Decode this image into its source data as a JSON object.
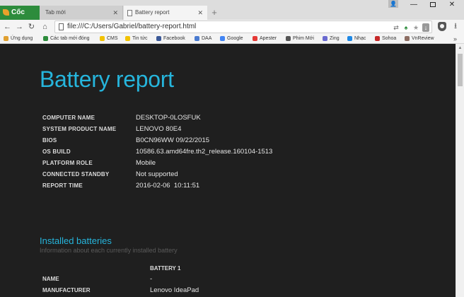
{
  "browser": {
    "brand": "Cốc Cốc",
    "tabs": [
      {
        "title": "Tab mới",
        "active": false
      },
      {
        "title": "Battery report",
        "active": true
      }
    ],
    "new_tab_symbol": "+",
    "window_controls": {
      "minimize": "—",
      "close": "✕"
    },
    "address": {
      "url": "file:///C:/Users/Gabriel/battery-report.html"
    },
    "bookmarks": [
      {
        "label": "Ứng dụng",
        "color": "#e0a030"
      },
      {
        "label": "Các tab mới đóng",
        "color": "#2d8c3c"
      },
      {
        "label": "CMS",
        "color": "#f2c200"
      },
      {
        "label": "Tin tức",
        "color": "#f2c200"
      },
      {
        "label": "Facebook",
        "color": "#3b5998"
      },
      {
        "label": "DAA",
        "color": "#4a7bd0"
      },
      {
        "label": "Google",
        "color": "#4285f4"
      },
      {
        "label": "Apester",
        "color": "#e53935"
      },
      {
        "label": "Phim Mới",
        "color": "#555555"
      },
      {
        "label": "Zing",
        "color": "#6a6ad0"
      },
      {
        "label": "Nhạc",
        "color": "#1e88e5"
      },
      {
        "label": "Sohoa",
        "color": "#c62828"
      },
      {
        "label": "VnReview",
        "color": "#8d6e63"
      }
    ],
    "more_bookmarks": "»"
  },
  "report": {
    "title": "Battery report",
    "info": [
      {
        "label": "COMPUTER NAME",
        "value": "DESKTOP-0LOSFUK"
      },
      {
        "label": "SYSTEM PRODUCT NAME",
        "value": "LENOVO 80E4"
      },
      {
        "label": "BIOS",
        "value": "B0CN96WW 09/22/2015"
      },
      {
        "label": "OS BUILD",
        "value": "10586.63.amd64fre.th2_release.160104-1513"
      },
      {
        "label": "PLATFORM ROLE",
        "value": "Mobile"
      },
      {
        "label": "CONNECTED STANDBY",
        "value": "Not supported"
      },
      {
        "label": "REPORT TIME",
        "value": "2016-02-06  10:11:51"
      }
    ],
    "installed": {
      "title": "Installed batteries",
      "subtitle": "Information about each currently installed battery",
      "column": "BATTERY 1",
      "rows": [
        {
          "label": "NAME",
          "value": "-"
        },
        {
          "label": "MANUFACTURER",
          "value": "Lenovo IdeaPad"
        }
      ]
    }
  },
  "colors": {
    "accent": "#26b5dc",
    "page_bg": "#1f1f1f",
    "brand_green": "#2d8c3c"
  }
}
